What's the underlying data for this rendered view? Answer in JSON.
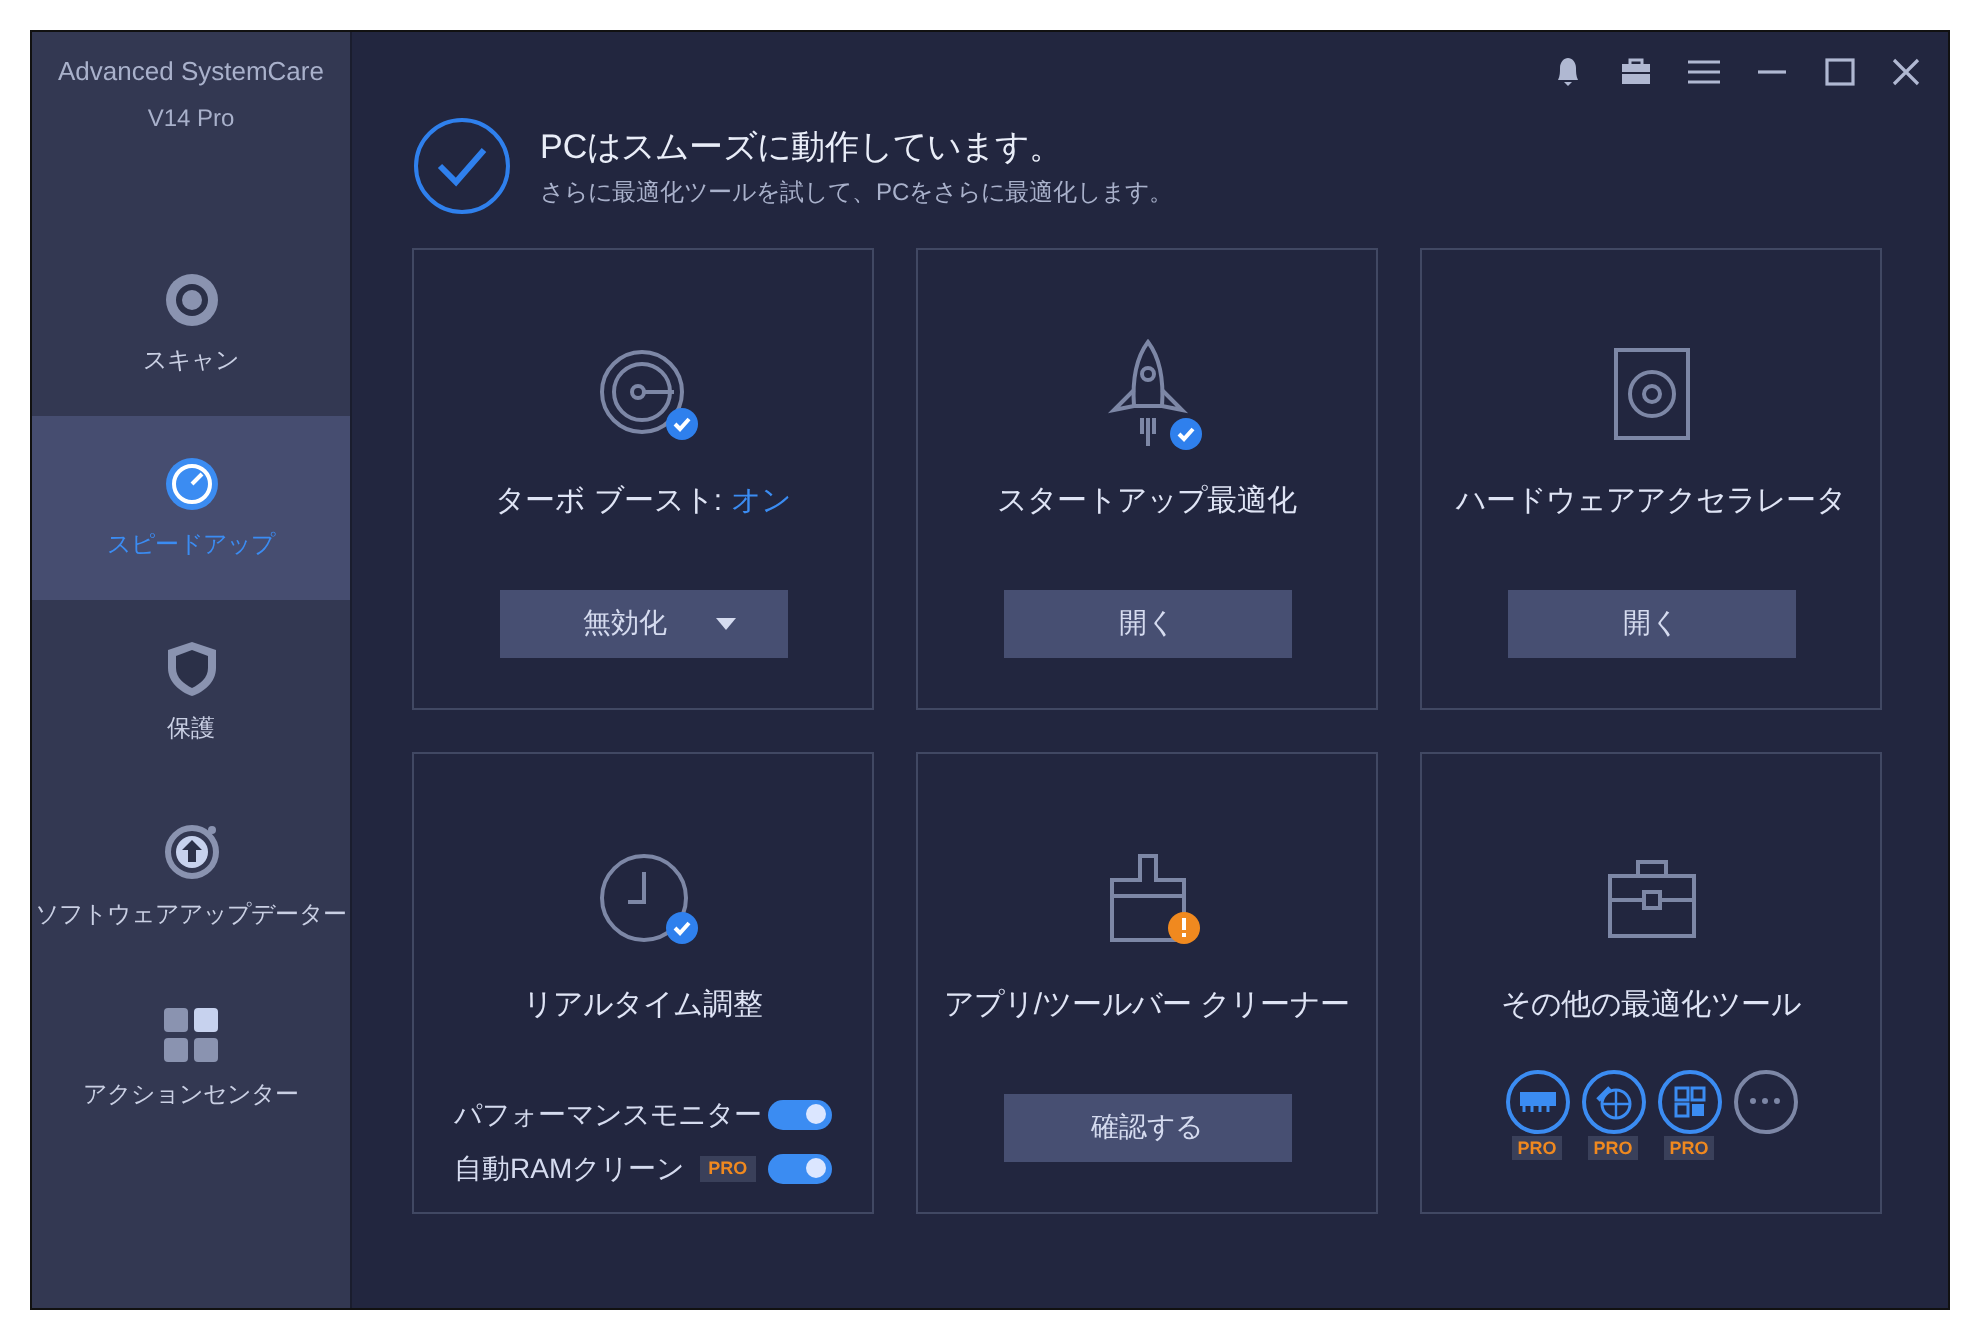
{
  "app": {
    "title": "Advanced SystemCare",
    "version": "V14 Pro"
  },
  "nav": [
    {
      "label": "スキャン",
      "selected": false
    },
    {
      "label": "スピードアップ",
      "selected": true
    },
    {
      "label": "保護",
      "selected": false
    },
    {
      "label": "ソフトウェアアップデーター",
      "selected": false
    },
    {
      "label": "アクションセンター",
      "selected": false
    }
  ],
  "header": {
    "title": "PCはスムーズに動作しています。",
    "subtitle": "さらに最適化ツールを試して、PCをさらに最適化します。"
  },
  "cards": [
    {
      "kind": "dropdown",
      "title": "ターボ ブースト: ",
      "status": "オン",
      "verified": true,
      "button": "無効化"
    },
    {
      "kind": "button",
      "title": "スタートアップ最適化",
      "verified": true,
      "button": "開く"
    },
    {
      "kind": "button",
      "title": "ハードウェアアクセラレータ",
      "button": "開く"
    },
    {
      "kind": "toggles",
      "title": "リアルタイム調整",
      "verified": true,
      "toggles": [
        {
          "label": "パフォーマンスモニター",
          "on": true
        },
        {
          "label": "自動RAMクリーン",
          "pro": "PRO",
          "on": true
        }
      ]
    },
    {
      "kind": "button",
      "title": "アプリ/ツールバー クリーナー",
      "alert": true,
      "button": "確認する"
    },
    {
      "kind": "tools",
      "title": "その他の最適化ツール",
      "tools": [
        {
          "kind": "tool",
          "pro": "PRO"
        },
        {
          "kind": "tool",
          "pro": "PRO"
        },
        {
          "kind": "tool",
          "pro": "PRO"
        },
        {
          "kind": "more"
        }
      ]
    }
  ]
}
